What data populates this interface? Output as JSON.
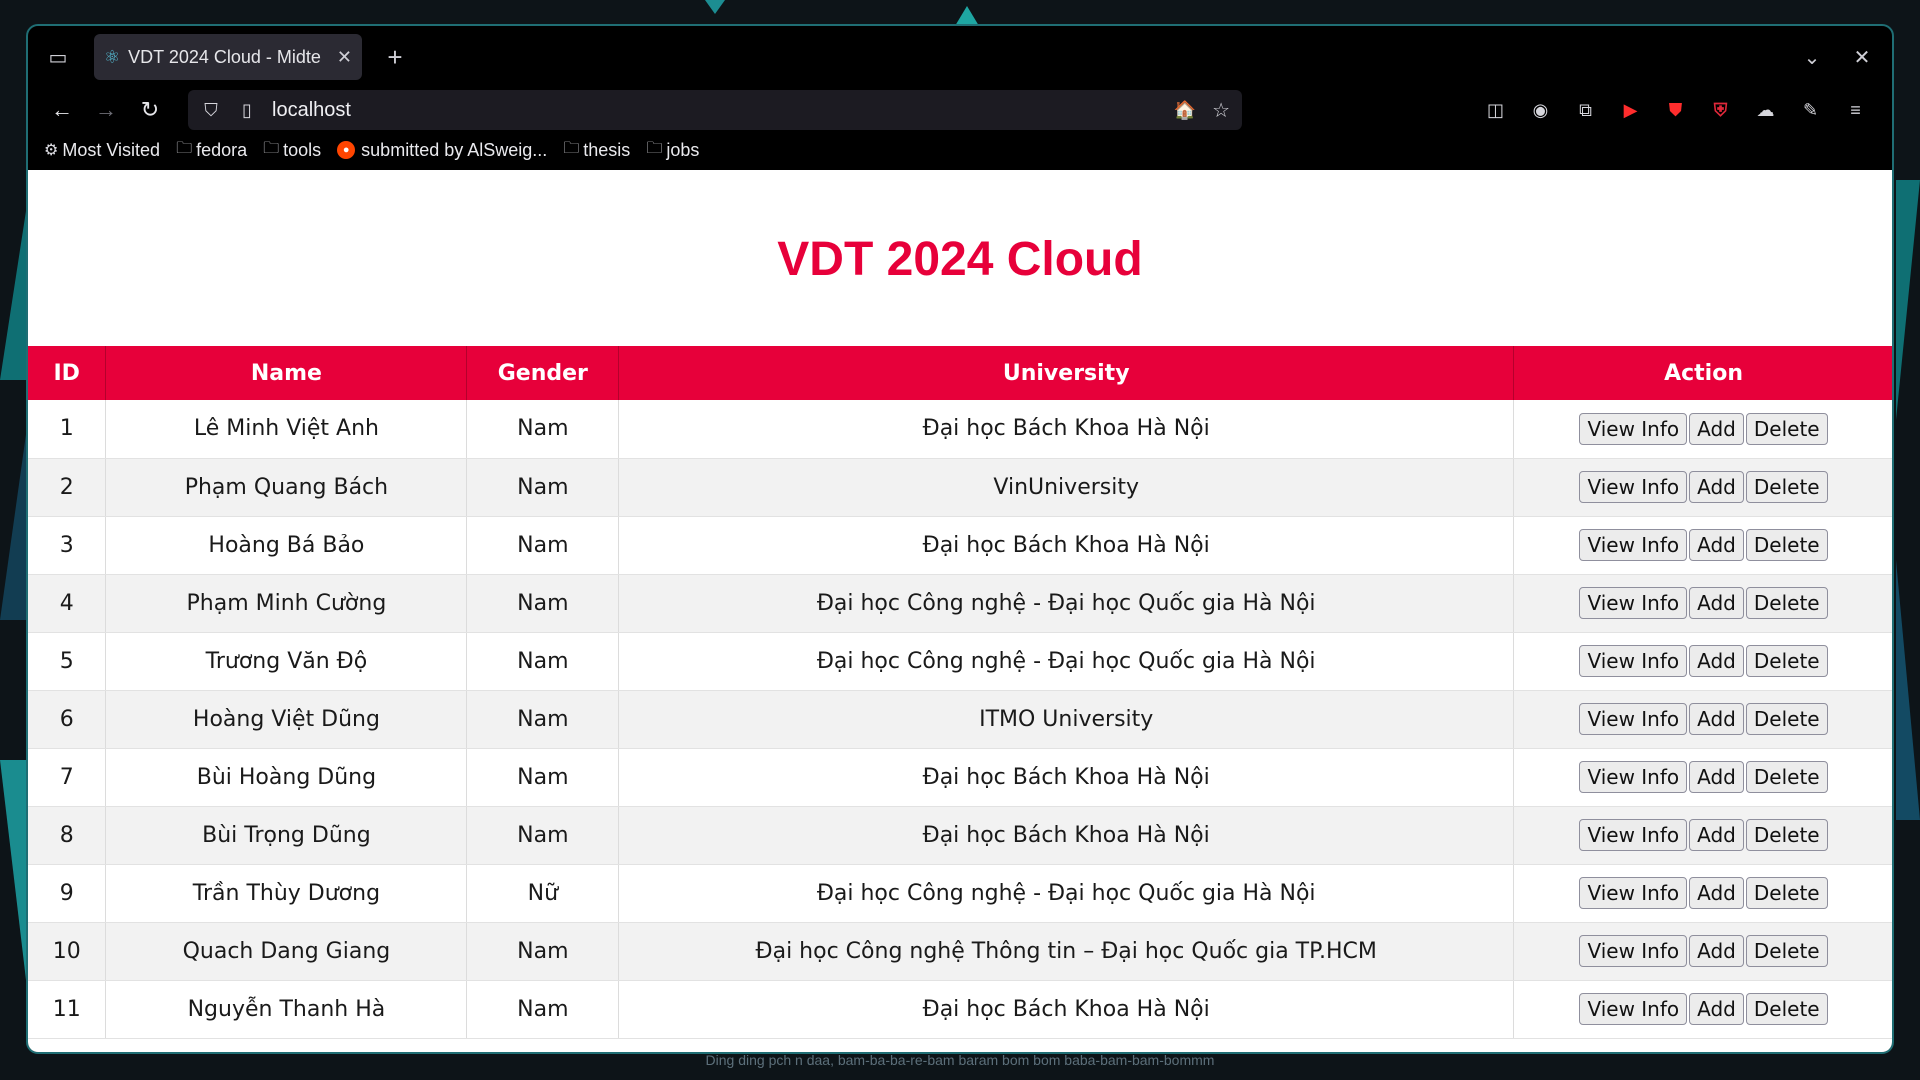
{
  "browser": {
    "tab_title": "VDT 2024 Cloud - Midte",
    "url": "localhost",
    "bookmarks": [
      "Most Visited",
      "fedora",
      "tools",
      "submitted by AlSweig...",
      "thesis",
      "jobs"
    ]
  },
  "page": {
    "title": "VDT 2024 Cloud",
    "accent_color": "#e7003a"
  },
  "table": {
    "headers": [
      "ID",
      "Name",
      "Gender",
      "University",
      "Action"
    ],
    "actions": [
      "View Info",
      "Add",
      "Delete"
    ],
    "rows": [
      [
        "1",
        "Lê Minh Việt Anh",
        "Nam",
        "Đại học Bách Khoa Hà Nội"
      ],
      [
        "2",
        "Phạm Quang Bách",
        "Nam",
        "VinUniversity"
      ],
      [
        "3",
        "Hoàng Bá Bảo",
        "Nam",
        "Đại học Bách Khoa Hà Nội"
      ],
      [
        "4",
        "Phạm Minh Cường",
        "Nam",
        "Đại học Công nghệ - Đại học Quốc gia Hà Nội"
      ],
      [
        "5",
        "Trương Văn Độ",
        "Nam",
        "Đại học Công nghệ - Đại học Quốc gia Hà Nội"
      ],
      [
        "6",
        "Hoàng Việt Dũng",
        "Nam",
        "ITMO University"
      ],
      [
        "7",
        "Bùi Hoàng Dũng",
        "Nam",
        "Đại học Bách Khoa Hà Nội"
      ],
      [
        "8",
        "Bùi Trọng Dũng",
        "Nam",
        "Đại học Bách Khoa Hà Nội"
      ],
      [
        "9",
        "Trần Thùy Dương",
        "Nữ",
        "Đại học Công nghệ - Đại học Quốc gia Hà Nội"
      ],
      [
        "10",
        "Quach Dang Giang",
        "Nam",
        "Đại học Công nghệ Thông tin – Đại học Quốc gia TP.HCM"
      ],
      [
        "11",
        "Nguyễn Thanh Hà",
        "Nam",
        "Đại học Bách Khoa Hà Nội"
      ]
    ]
  },
  "desktop": {
    "now_playing": "Ding ding pch n daa, bam-ba-ba-re-bam baram bom bom baba-bam-bam-bommm"
  }
}
